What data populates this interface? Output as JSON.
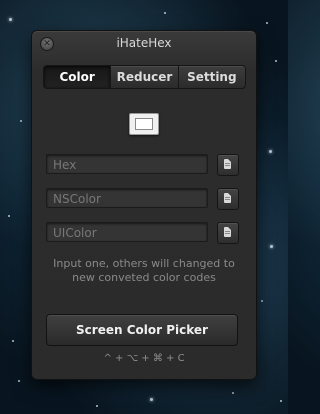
{
  "window": {
    "title": "iHateHex"
  },
  "tabs": [
    {
      "label": "Color",
      "active": true
    },
    {
      "label": "Reducer",
      "active": false
    },
    {
      "label": "Setting",
      "active": false
    }
  ],
  "swatch": {
    "color": "#ffffff"
  },
  "fields": {
    "hex": {
      "placeholder": "Hex",
      "value": ""
    },
    "nscolor": {
      "placeholder": "NSColor",
      "value": ""
    },
    "uicolor": {
      "placeholder": "UIColor",
      "value": ""
    }
  },
  "icons": {
    "copy": "document-icon",
    "close": "close-icon"
  },
  "hint": {
    "line1": "Input one, others will changed to",
    "line2": "new conveted color codes"
  },
  "picker_button": {
    "label": "Screen Color Picker"
  },
  "shortcut": {
    "text": "^ + ⌥ + ⌘ + C"
  }
}
